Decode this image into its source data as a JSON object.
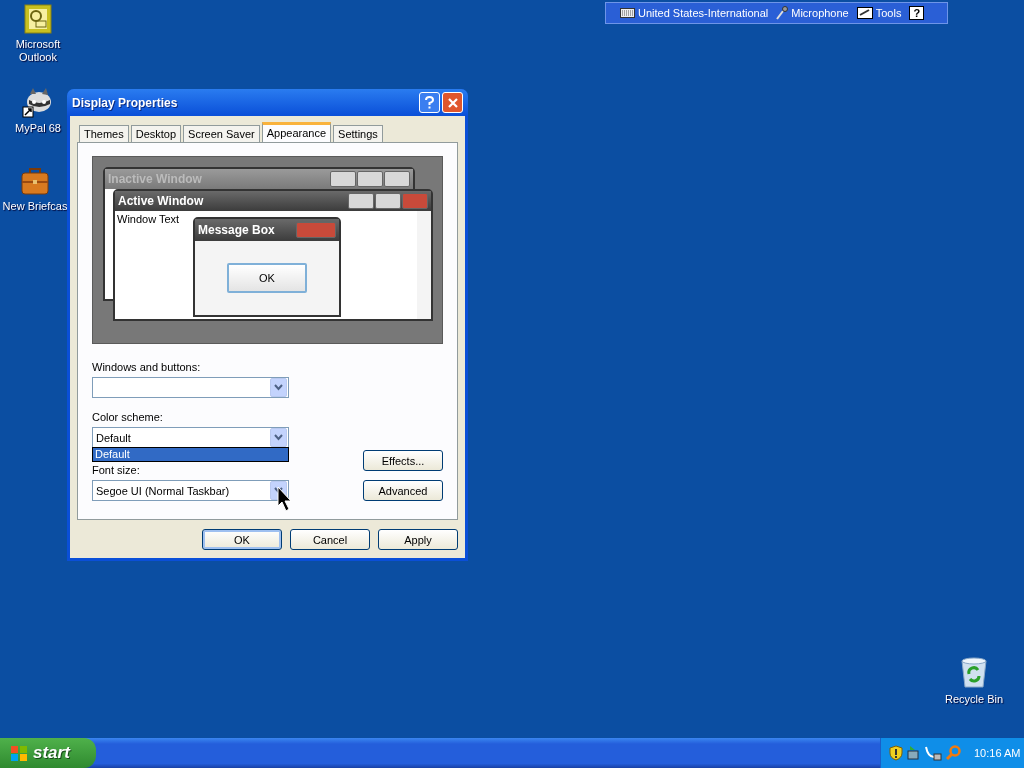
{
  "desktop_icons": [
    {
      "kind": "outlook",
      "label": "Microsoft Outlook"
    },
    {
      "kind": "raccoon",
      "label": "MyPal 68"
    },
    {
      "kind": "briefcase",
      "label": "New Briefcas"
    },
    {
      "kind": "recycle",
      "label": "Recycle Bin"
    }
  ],
  "language_bar": {
    "items": [
      {
        "kind": "keyboard",
        "label": "United States-International"
      },
      {
        "kind": "microphone",
        "label": "Microphone"
      },
      {
        "kind": "tools",
        "label": "Tools"
      }
    ],
    "help": "?"
  },
  "window": {
    "title": "Display Properties",
    "tabs": [
      {
        "label": "Themes",
        "selected": false
      },
      {
        "label": "Desktop",
        "selected": false
      },
      {
        "label": "Screen Saver",
        "selected": false
      },
      {
        "label": "Appearance",
        "selected": true
      },
      {
        "label": "Settings",
        "selected": false
      }
    ],
    "preview": {
      "inactive_title": "Inactive Window",
      "active_title": "Active Window",
      "window_text": "Window Text",
      "message_title": "Message Box",
      "message_button": "OK"
    },
    "fields": [
      {
        "label": "Windows and buttons:"
      },
      {
        "label": "Color scheme:",
        "value": "Default",
        "options": [
          {
            "label": "Default",
            "selected": true
          }
        ]
      },
      {
        "label": "Font size:",
        "value": "Segoe UI (Normal Taskbar)"
      }
    ],
    "side_buttons": [
      "Effects...",
      "Advanced"
    ],
    "buttons": [
      {
        "label": "OK",
        "default": true
      },
      {
        "label": "Cancel",
        "default": false
      },
      {
        "label": "Apply",
        "default": false
      }
    ]
  },
  "taskbar": {
    "start": "start",
    "clock": "10:16 AM"
  }
}
